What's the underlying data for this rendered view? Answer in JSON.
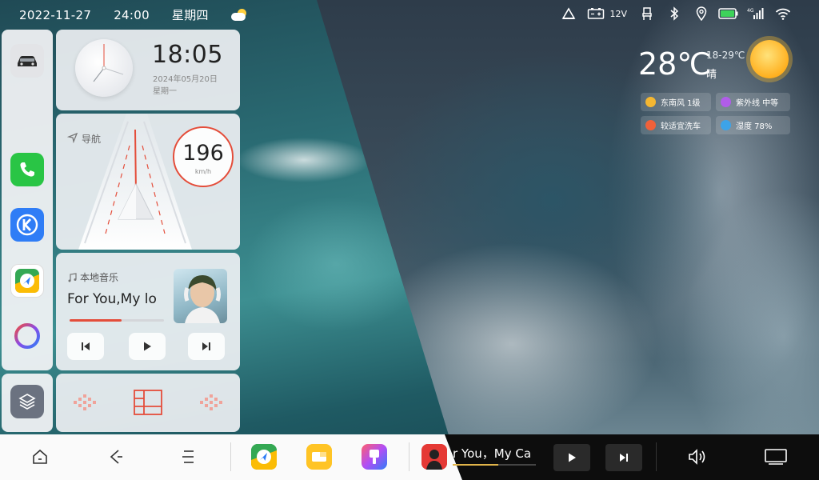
{
  "status_bar": {
    "date": "2022-11-27",
    "time": "24:00",
    "weekday": "星期四",
    "voltage": "12V",
    "icons": [
      "warning-triangle-icon",
      "battery-outline-icon",
      "seat-icon",
      "bluetooth-icon",
      "location-pin-icon",
      "battery-charging-icon",
      "4g-signal-icon",
      "wifi-icon"
    ]
  },
  "dock": {
    "apps": [
      "car-icon",
      "phone-icon",
      "k-app-icon",
      "maps-icon",
      "voice-assistant-icon"
    ],
    "bottom_app": "layers-icon"
  },
  "clock_widget": {
    "time": "18:05",
    "date": "2024年05月20日",
    "weekday": "星期一"
  },
  "nav_widget": {
    "title": "导航",
    "speed": "196",
    "speed_unit": "km/h"
  },
  "music_widget": {
    "source": "本地音乐",
    "song": "For You,My lo",
    "progress": 0.55
  },
  "weather": {
    "temperature": "28℃",
    "range": "18-29℃",
    "condition": "晴",
    "chips": [
      {
        "label": "东南风 1级",
        "color": "#f5b731"
      },
      {
        "label": "紫外线 中等",
        "color": "#b15de9"
      },
      {
        "label": "较适宜洗车",
        "color": "#f0613a"
      },
      {
        "label": "湿度 78%",
        "color": "#3da3e8"
      }
    ]
  },
  "bottom_bar": {
    "nav_buttons": [
      "home-icon",
      "back-icon",
      "menu-icon"
    ],
    "apps": [
      "maps-icon",
      "notes-icon",
      "paint-icon"
    ],
    "mini_player_song": "r You，My Ca",
    "mini_player_progress": 0.55
  },
  "colors": {
    "accent_red": "#e44d3a",
    "card_bg": "#eef0f3"
  }
}
